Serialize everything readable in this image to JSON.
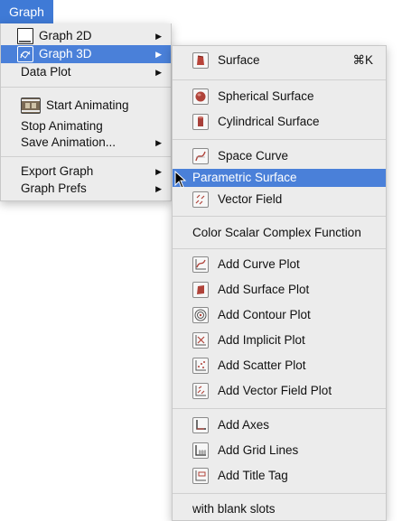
{
  "menubar": {
    "title": "Graph"
  },
  "main_menu": {
    "graph_2d": "Graph 2D",
    "graph_3d": "Graph 3D",
    "data_plot": "Data Plot",
    "start_animating": "Start Animating",
    "stop_animating": "Stop Animating",
    "save_animation": "Save Animation...",
    "export_graph": "Export Graph",
    "graph_prefs": "Graph Prefs"
  },
  "submenu": {
    "surface": "Surface",
    "surface_shortcut": "⌘K",
    "spherical_surface": "Spherical Surface",
    "cylindrical_surface": "Cylindrical Surface",
    "space_curve": "Space Curve",
    "parametric_surface": "Parametric Surface",
    "vector_field": "Vector Field",
    "color_scalar": "Color Scalar Complex Function",
    "add_curve_plot": "Add Curve Plot",
    "add_surface_plot": "Add Surface Plot",
    "add_contour_plot": "Add Contour Plot",
    "add_implicit_plot": "Add Implicit Plot",
    "add_scatter_plot": "Add Scatter Plot",
    "add_vector_field_plot": "Add Vector Field Plot",
    "add_axes": "Add Axes",
    "add_grid_lines": "Add Grid Lines",
    "add_title_tag": "Add Title Tag",
    "blank_slots": "with blank slots"
  },
  "colors": {
    "highlight": "#4a80d9",
    "menubar": "#3f7ad6",
    "menu_bg": "#ececec"
  },
  "icons": [
    "graph-2d-icon",
    "graph-3d-icon",
    "film-icon",
    "surface-icon",
    "spherical-surface-icon",
    "cylindrical-surface-icon",
    "space-curve-icon",
    "vector-field-icon",
    "curve-plot-icon",
    "surface-plot-icon",
    "contour-plot-icon",
    "implicit-plot-icon",
    "scatter-plot-icon",
    "vector-field-plot-icon",
    "axes-icon",
    "grid-lines-icon",
    "title-tag-icon"
  ]
}
